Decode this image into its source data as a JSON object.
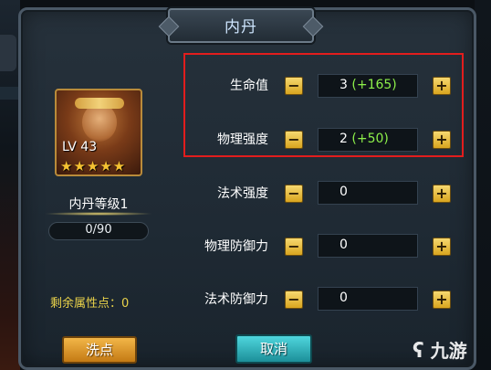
{
  "title": "内丹",
  "hero": {
    "level_label": "LV 43",
    "stars": "★★★★★",
    "star_count": 5,
    "portrait_icon": "monkey-king-portrait-icon"
  },
  "neidan_level": "内丹等级1",
  "xp": "0/90",
  "remaining_points": "剩余属性点：0",
  "stats": [
    {
      "label": "生命值",
      "value": "3",
      "bonus": "(+165)"
    },
    {
      "label": "物理强度",
      "value": "2",
      "bonus": "(+50)"
    },
    {
      "label": "法术强度",
      "value": "0",
      "bonus": ""
    },
    {
      "label": "物理防御力",
      "value": "0",
      "bonus": ""
    },
    {
      "label": "法术防御力",
      "value": "0",
      "bonus": ""
    }
  ],
  "buttons": {
    "minus": "−",
    "plus": "+",
    "wash": "洗点",
    "cancel": "取消"
  },
  "watermark": "九游",
  "colors": {
    "highlight_border": "#e21d1d",
    "bonus_green": "#8df04a",
    "remaining_yellow": "#e9d24a",
    "stepper_gold": "#d9a51f"
  }
}
